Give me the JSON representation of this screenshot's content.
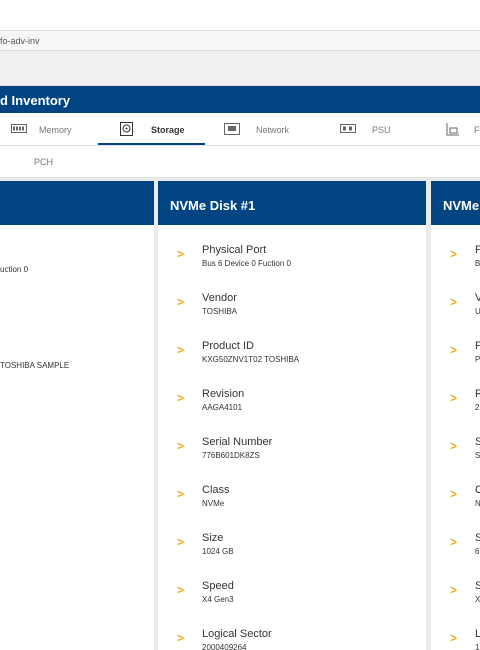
{
  "browser": {
    "url_fragment": "fo-adv-inv"
  },
  "header": {
    "title": "d Inventory"
  },
  "tabs": [
    {
      "label": "Memory",
      "icon": "memory-icon"
    },
    {
      "label": "Storage",
      "icon": "storage-icon"
    },
    {
      "label": "Network",
      "icon": "network-icon"
    },
    {
      "label": "PSU",
      "icon": "psu-icon"
    },
    {
      "label": "F",
      "icon": "fan-icon"
    }
  ],
  "subtabs": {
    "pch": "PCH"
  },
  "cards": {
    "left": {
      "values": [
        "uction 0",
        "TOSHIBA SAMPLE"
      ]
    },
    "middle": {
      "title": "NVMe Disk #1",
      "rows": [
        {
          "label": "Physical Port",
          "value": "Bus 6 Device 0 Fuction 0"
        },
        {
          "label": "Vendor",
          "value": "TOSHIBA"
        },
        {
          "label": "Product ID",
          "value": "KXG50ZNV1T02 TOSHIBA"
        },
        {
          "label": "Revision",
          "value": "AAGA4101"
        },
        {
          "label": "Serial Number",
          "value": "776B601DK8ZS"
        },
        {
          "label": "Class",
          "value": "NVMe"
        },
        {
          "label": "Size",
          "value": "1024 GB"
        },
        {
          "label": "Speed",
          "value": "X4 Gen3"
        },
        {
          "label": "Logical Sector",
          "value": "2000409264"
        }
      ]
    },
    "right": {
      "title": "NVMe",
      "rows": [
        {
          "label": "P",
          "value": "B"
        },
        {
          "label": "V",
          "value": "U"
        },
        {
          "label": "P",
          "value": "P"
        },
        {
          "label": "R",
          "value": "2"
        },
        {
          "label": "S",
          "value": "S"
        },
        {
          "label": "C",
          "value": "N"
        },
        {
          "label": "S",
          "value": "6"
        },
        {
          "label": "S",
          "value": "X"
        },
        {
          "label": "L",
          "value": "1"
        }
      ]
    }
  },
  "colors": {
    "primary": "#004582",
    "accent": "#f5a623"
  }
}
